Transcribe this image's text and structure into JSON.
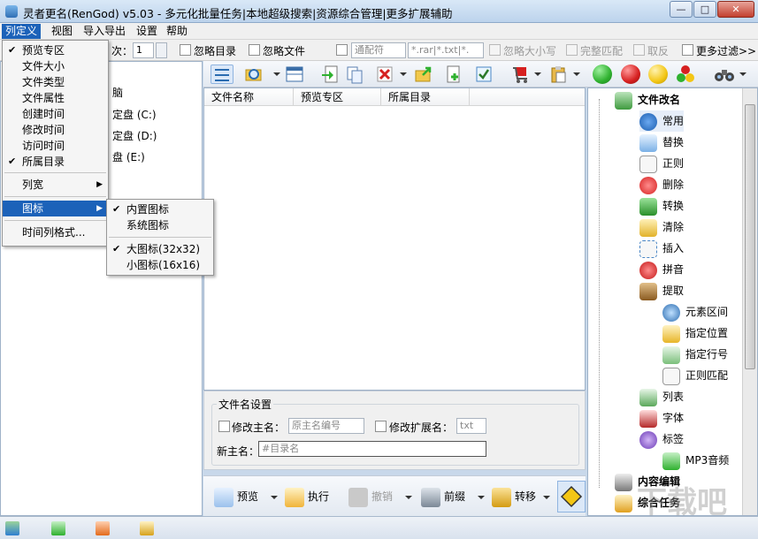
{
  "title": "灵者更名(RenGod) v5.03 - 多元化批量任务|本地超级搜索|资源综合管理|更多扩展辅助",
  "window_buttons": {
    "minimize": "—",
    "maximize": "□",
    "close": "✕"
  },
  "menu": [
    "列定义",
    "视图",
    "导入导出",
    "设置",
    "帮助"
  ],
  "options": {
    "level_label": "次：",
    "level_value": "1",
    "ignore_dir": "忽略目录",
    "ignore_file": "忽略文件",
    "wildcard": "通配符",
    "ext_filter": "*.rar|*.txt|*.",
    "ignore_case": "忽略大小写",
    "exact_match": "完整匹配",
    "invert": "取反",
    "more_filter": "更多过滤>>"
  },
  "left_tree": [
    "脑",
    "定盘 (C:)",
    "定盘 (D:)",
    "盘 (E:)"
  ],
  "columns": [
    "文件名称",
    "预览专区",
    "所属目录"
  ],
  "filename_settings": {
    "title": "文件名设置",
    "modify_main": "修改主名：",
    "main_placeholder": "原主名编号",
    "modify_ext": "修改扩展名：",
    "ext_value": "txt",
    "new_main": "新主名：",
    "new_main_value": "#目录名"
  },
  "bottom_buttons": [
    "预览",
    "执行",
    "撤销",
    "前缀",
    "转移"
  ],
  "right_tree": {
    "root": "文件改名",
    "items": [
      "常用",
      "替换",
      "正则",
      "删除",
      "转换",
      "清除",
      "插入",
      "拼音",
      "提取"
    ],
    "extract_children": [
      "元素区间",
      "指定位置",
      "指定行号",
      "正则匹配"
    ],
    "items2": [
      "列表",
      "字体",
      "标签"
    ],
    "tag_children": [
      "MP3音频"
    ],
    "other_roots": [
      "内容编辑",
      "综合任务"
    ]
  },
  "column_menu": {
    "items": [
      {
        "label": "预览专区",
        "checked": true
      },
      {
        "label": "文件大小",
        "checked": false
      },
      {
        "label": "文件类型",
        "checked": false
      },
      {
        "label": "文件属性",
        "checked": false
      },
      {
        "label": "创建时间",
        "checked": false
      },
      {
        "label": "修改时间",
        "checked": false
      },
      {
        "label": "访问时间",
        "checked": false
      },
      {
        "label": "所属目录",
        "checked": true
      }
    ],
    "width": "列宽",
    "icon": "图标",
    "time_format": "时间列格式..."
  },
  "icon_submenu": [
    {
      "label": "内置图标",
      "checked": true
    },
    {
      "label": "系统图标",
      "checked": false
    },
    {
      "label": "大图标(32x32)",
      "checked": true
    },
    {
      "label": "小图标(16x16)",
      "checked": false
    }
  ],
  "watermark": "下载吧",
  "colors": {
    "accent": "#1c62b9",
    "green": "#2fb12f",
    "red": "#d62020",
    "yellow": "#f3c615"
  }
}
